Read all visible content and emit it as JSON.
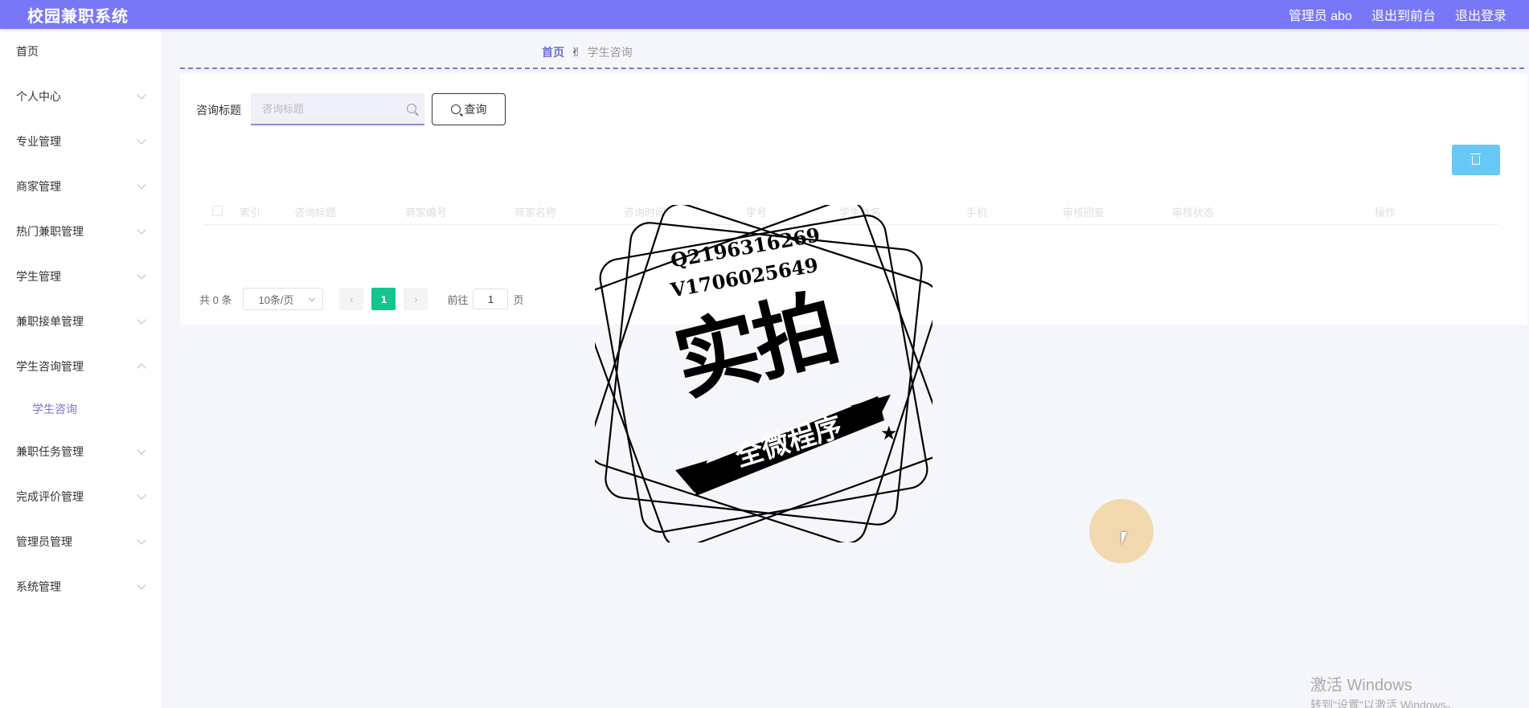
{
  "header": {
    "app_title": "校园兼职系统",
    "admin_label": "管理员 abo",
    "to_front_label": "退出到前台",
    "logout_label": "退出登录"
  },
  "sidebar": {
    "home_label": "首页",
    "items": [
      {
        "label": "个人中心",
        "expanded": false
      },
      {
        "label": "专业管理",
        "expanded": false
      },
      {
        "label": "商家管理",
        "expanded": false
      },
      {
        "label": "热门兼职管理",
        "expanded": false
      },
      {
        "label": "学生管理",
        "expanded": false
      },
      {
        "label": "兼职接单管理",
        "expanded": false
      },
      {
        "label": "学生咨询管理",
        "expanded": true,
        "children": [
          "学生咨询"
        ]
      },
      {
        "label": "兼职任务管理",
        "expanded": false
      },
      {
        "label": "完成评价管理",
        "expanded": false
      },
      {
        "label": "管理员管理",
        "expanded": false
      },
      {
        "label": "系统管理",
        "expanded": false
      }
    ]
  },
  "breadcrumb": {
    "home": "首页",
    "separator_icon": "✌",
    "current": "学生咨询"
  },
  "search": {
    "label": "咨询标题",
    "placeholder": "咨询标题",
    "value": "",
    "query_button": "查询"
  },
  "table": {
    "columns": [
      "索引",
      "咨询标题",
      "商家编号",
      "商家名称",
      "咨询时间",
      "学号",
      "学生姓名",
      "手机",
      "审核回复",
      "审核状态",
      "操作"
    ],
    "rows": []
  },
  "pagination": {
    "total_text": "共 0 条",
    "page_size": "10条/页",
    "current_page": "1",
    "goto_label": "前往",
    "goto_value": "1",
    "page_unit": "页"
  },
  "watermark": {
    "line1": "Q2196316269",
    "line2": "V1706025649",
    "big": "实拍",
    "band": "全微程序"
  },
  "windows": {
    "activate_title": "激活 Windows",
    "activate_sub": "转到\"设置\"以激活 Windows。"
  },
  "colors": {
    "header_bg": "#7777f7",
    "accent": "#6f6fd6",
    "page_active": "#13c48f",
    "delete_btn": "#67c8f5"
  }
}
